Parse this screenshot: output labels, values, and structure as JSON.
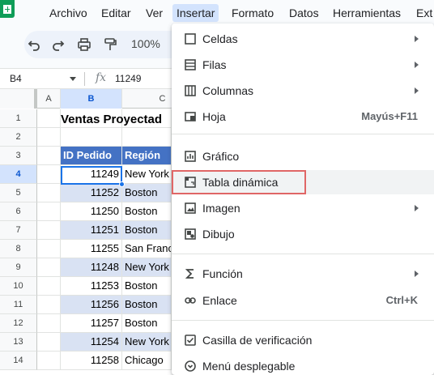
{
  "menubar": {
    "items": [
      {
        "label": "Archivo"
      },
      {
        "label": "Editar"
      },
      {
        "label": "Ver"
      },
      {
        "label": "Insertar"
      },
      {
        "label": "Formato"
      },
      {
        "label": "Datos"
      },
      {
        "label": "Herramientas"
      },
      {
        "label": "Ext"
      }
    ],
    "active": "Insertar"
  },
  "toolbar": {
    "icons": [
      "undo-icon",
      "redo-icon",
      "print-icon",
      "paint-format-icon"
    ],
    "zoom": "100%"
  },
  "formula_bar": {
    "cell_ref": "B4",
    "fx_icon": "fx-icon",
    "value": "11249"
  },
  "grid": {
    "columns": [
      "A",
      "B",
      "C"
    ],
    "selected_column": "B",
    "rows": [
      "1",
      "2",
      "3",
      "4",
      "5",
      "6",
      "7",
      "8",
      "9",
      "10",
      "11",
      "12",
      "13",
      "14"
    ],
    "selected_row": "4",
    "title": "Ventas Proyectad",
    "headers": [
      "ID Pedido",
      "Región"
    ],
    "data": [
      {
        "id": "11249",
        "region": "New York"
      },
      {
        "id": "11252",
        "region": "Boston"
      },
      {
        "id": "11250",
        "region": "Boston"
      },
      {
        "id": "11251",
        "region": "Boston"
      },
      {
        "id": "11255",
        "region": "San Franc"
      },
      {
        "id": "11248",
        "region": "New York"
      },
      {
        "id": "11253",
        "region": "Boston"
      },
      {
        "id": "11256",
        "region": "Boston"
      },
      {
        "id": "11257",
        "region": "Boston"
      },
      {
        "id": "11254",
        "region": "New York"
      },
      {
        "id": "11258",
        "region": "Chicago"
      }
    ],
    "header_color": "#4472c4",
    "band_color": "#d9e2f3",
    "selection_color": "#1a73e8"
  },
  "insert_menu": {
    "items": [
      {
        "label": "Celdas",
        "icon": "checkbox-square-icon",
        "submenu": true
      },
      {
        "label": "Filas",
        "icon": "rows-icon",
        "submenu": true
      },
      {
        "label": "Columnas",
        "icon": "columns-icon",
        "submenu": true
      },
      {
        "label": "Hoja",
        "icon": "sheet-icon",
        "shortcut": "Mayús+F11"
      },
      {
        "label": "Gráfico",
        "icon": "chart-icon"
      },
      {
        "label": "Tabla dinámica",
        "icon": "pivot-table-icon",
        "highlighted": true
      },
      {
        "label": "Imagen",
        "icon": "image-icon",
        "submenu": true
      },
      {
        "label": "Dibujo",
        "icon": "drawing-icon"
      },
      {
        "label": "Función",
        "icon": "sigma-icon",
        "submenu": true
      },
      {
        "label": "Enlace",
        "icon": "link-icon",
        "shortcut": "Ctrl+K"
      },
      {
        "label": "Casilla de verificación",
        "icon": "checkbox-icon"
      },
      {
        "label": "Menú desplegable",
        "icon": "dropdown-icon"
      }
    ],
    "highlight_color": "#e06666"
  }
}
